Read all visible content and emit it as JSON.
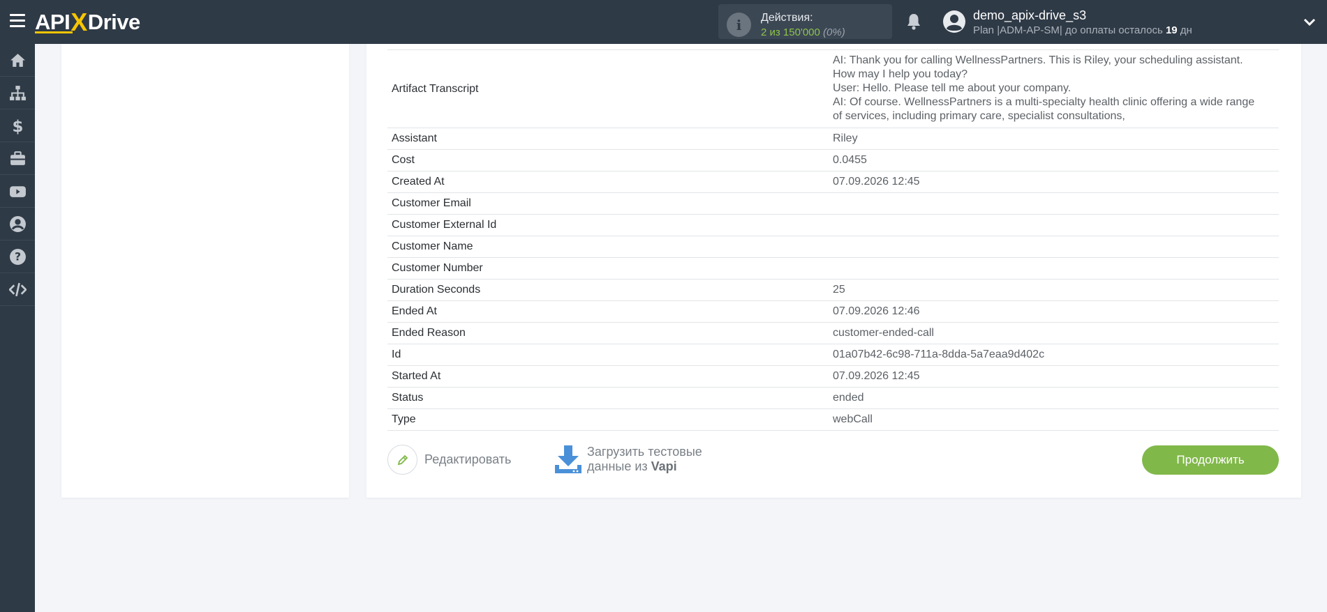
{
  "header": {
    "logo": {
      "left": "API",
      "x": "X",
      "right": "Drive"
    },
    "actions": {
      "label": "Действия:",
      "count": "2 из 150'000",
      "percent": "(0%)"
    },
    "user": {
      "name": "demo_apix-drive_s3",
      "plan_prefix": "Plan |ADM-AP-SM| до оплаты осталось ",
      "days": "19",
      "days_suffix": " дн"
    }
  },
  "sidebar": {
    "items": [
      {
        "icon": "home-icon"
      },
      {
        "icon": "sitemap-icon"
      },
      {
        "icon": "dollar-icon"
      },
      {
        "icon": "briefcase-icon"
      },
      {
        "icon": "youtube-icon"
      },
      {
        "icon": "user-circle-icon"
      },
      {
        "icon": "question-icon"
      },
      {
        "icon": "code-icon"
      }
    ]
  },
  "table": {
    "rows": [
      {
        "key": "Artifact Transcript",
        "value": "AI: Thank you for calling WellnessPartners. This is Riley, your scheduling assistant.\nHow may I help you today?\nUser: Hello. Please tell me about your company.\nAI: Of course. WellnessPartners is a multi-specialty health clinic offering a wide range\nof services, including primary care, specialist consultations,"
      },
      {
        "key": "Assistant",
        "value": "Riley"
      },
      {
        "key": "Cost",
        "value": "0.0455"
      },
      {
        "key": "Created At",
        "value": "07.09.2026 12:45"
      },
      {
        "key": "Customer Email",
        "value": ""
      },
      {
        "key": "Customer External Id",
        "value": ""
      },
      {
        "key": "Customer Name",
        "value": ""
      },
      {
        "key": "Customer Number",
        "value": ""
      },
      {
        "key": "Duration Seconds",
        "value": "25"
      },
      {
        "key": "Ended At",
        "value": "07.09.2026 12:46"
      },
      {
        "key": "Ended Reason",
        "value": "customer-ended-call"
      },
      {
        "key": "Id",
        "value": "01a07b42-6c98-711a-8dda-5a7eaa9d402c"
      },
      {
        "key": "Started At",
        "value": "07.09.2026 12:45"
      },
      {
        "key": "Status",
        "value": "ended"
      },
      {
        "key": "Type",
        "value": "webCall"
      }
    ]
  },
  "buttons": {
    "edit": "Редактировать",
    "load_line1": "Загрузить тестовые",
    "load_line2": "данные из ",
    "load_source": "Vapi",
    "continue": "Продолжить"
  },
  "colors": {
    "topbar": "#2f3a47",
    "accent_green": "#81b84a",
    "logo_yellow": "#f7c600",
    "download_blue": "#4a90d9"
  }
}
